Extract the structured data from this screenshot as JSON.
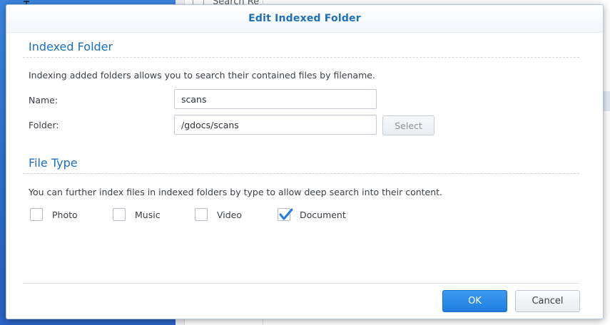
{
  "background": {
    "search_label": "Search Re"
  },
  "dialog": {
    "title": "Edit Indexed Folder",
    "indexed_folder": {
      "heading": "Indexed Folder",
      "description": "Indexing added folders allows you to search their contained files by filename.",
      "name_label": "Name:",
      "name_value": "scans",
      "folder_label": "Folder:",
      "folder_value": "/gdocs/scans",
      "select_button": "Select"
    },
    "file_type": {
      "heading": "File Type",
      "description": "You can further index files in indexed folders by type to allow deep search into their content.",
      "options": [
        {
          "label": "Photo",
          "checked": false
        },
        {
          "label": "Music",
          "checked": false
        },
        {
          "label": "Video",
          "checked": false
        },
        {
          "label": "Document",
          "checked": true
        }
      ]
    },
    "buttons": {
      "ok": "OK",
      "cancel": "Cancel"
    }
  },
  "colors": {
    "accent": "#1d6fb8",
    "primary_button": "#2a88e8",
    "check_mark": "#1f7ee0"
  }
}
